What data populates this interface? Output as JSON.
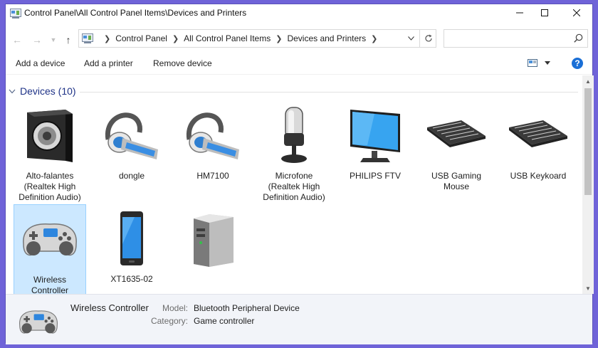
{
  "window": {
    "title": "Control Panel\\All Control Panel Items\\Devices and Printers",
    "controls": [
      "minimize-icon",
      "maximize-icon",
      "close-icon"
    ]
  },
  "address": {
    "crumbs": [
      "Control Panel",
      "All Control Panel Items",
      "Devices and Printers"
    ],
    "search_placeholder": ""
  },
  "commands": {
    "add_device": "Add a device",
    "add_printer": "Add a printer",
    "remove_device": "Remove device",
    "help": "?"
  },
  "group": {
    "title": "Devices (10)"
  },
  "devices": [
    {
      "label": "Alto-falantes\n(Realtek High\nDefinition Audio)",
      "icon": "speaker-icon"
    },
    {
      "label": "dongle",
      "icon": "headset-icon"
    },
    {
      "label": "HM7100",
      "icon": "headset-icon"
    },
    {
      "label": "Microfone\n(Realtek High\nDefinition Audio)",
      "icon": "microphone-icon"
    },
    {
      "label": "PHILIPS FTV",
      "icon": "monitor-icon"
    },
    {
      "label": "USB Gaming\nMouse",
      "icon": "keyboard-icon"
    },
    {
      "label": "USB Keykoard",
      "icon": "keyboard-icon"
    },
    {
      "label": "Wireless\nController",
      "icon": "gamepad-icon",
      "selected": true
    },
    {
      "label": "XT1635-02",
      "icon": "phone-icon"
    },
    {
      "label": "",
      "icon": "computer-icon"
    }
  ],
  "details": {
    "name": "Wireless Controller",
    "model_label": "Model:",
    "model_value": "Bluetooth Peripheral Device",
    "category_label": "Category:",
    "category_value": "Game controller"
  },
  "colors": {
    "accent": "#1e3287",
    "selection": "#cce8ff",
    "help": "#1a6fd6"
  }
}
